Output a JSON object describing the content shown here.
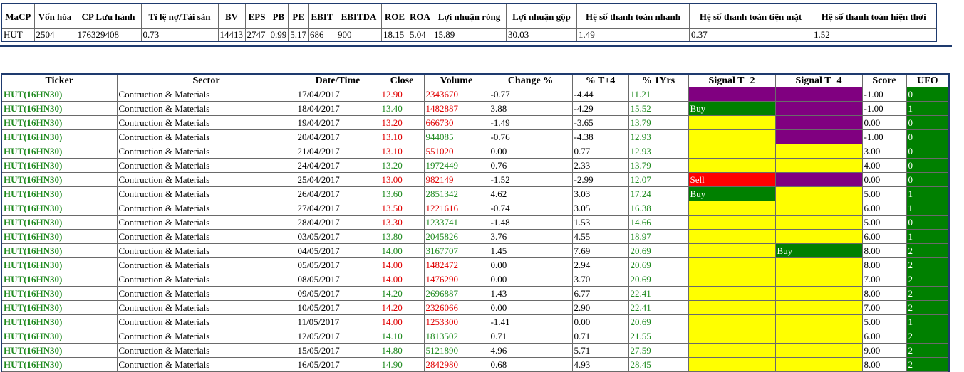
{
  "summary": {
    "headers": [
      "MaCP",
      "Vốn hóa",
      "CP Lưu hành",
      "Tỉ lệ nợ/Tài sản",
      "BV",
      "EPS",
      "PB",
      "PE",
      "EBIT",
      "EBITDA",
      "ROE",
      "ROA",
      "Lợi nhuận ròng",
      "Lợi nhuận gộp",
      "Hệ số thanh toán nhanh",
      "Hệ số thanh toán tiện mặt",
      "Hệ số thanh toán hiện thời"
    ],
    "values": [
      "HUT",
      "2504",
      "176329408",
      "0.73",
      "14413",
      "2747",
      "0.99",
      "5.17",
      "686",
      "900",
      "18.15",
      "5.04",
      "15.89",
      "30.03",
      "1.49",
      "0.37",
      "1.52"
    ]
  },
  "main": {
    "headers": [
      "Ticker",
      "Sector",
      "Date/Time",
      "Close",
      "Volume",
      "Change %",
      "% T+4",
      "% 1Yrs",
      "Signal T+2",
      "Signal T+4",
      "Score",
      "UFO"
    ],
    "rows": [
      {
        "ticker": "HUT(16HN30)",
        "sector": "Contruction & Materials",
        "date": "17/04/2017",
        "close": "12.90",
        "volume": "2343670",
        "change": "-0.77",
        "t4": "-4.44",
        "yr": "11.21",
        "sig2": "",
        "sig2c": "purple",
        "sig4": "",
        "sig4c": "purple",
        "score": "-1.00",
        "ufo": "0",
        "dir": "red"
      },
      {
        "ticker": "HUT(16HN30)",
        "sector": "Contruction & Materials",
        "date": "18/04/2017",
        "close": "13.40",
        "volume": "1482887",
        "change": "3.88",
        "t4": "-4.29",
        "yr": "15.52",
        "sig2": "Buy",
        "sig2c": "green",
        "sig4": "",
        "sig4c": "purple",
        "score": "-1.00",
        "ufo": "1",
        "dir": "green-red"
      },
      {
        "ticker": "HUT(16HN30)",
        "sector": "Contruction & Materials",
        "date": "19/04/2017",
        "close": "13.20",
        "volume": "666730",
        "change": "-1.49",
        "t4": "-3.65",
        "yr": "13.79",
        "sig2": "",
        "sig2c": "yellow",
        "sig4": "",
        "sig4c": "purple",
        "score": "0.00",
        "ufo": "0",
        "dir": "red"
      },
      {
        "ticker": "HUT(16HN30)",
        "sector": "Contruction & Materials",
        "date": "20/04/2017",
        "close": "13.10",
        "volume": "944085",
        "change": "-0.76",
        "t4": "-4.38",
        "yr": "12.93",
        "sig2": "",
        "sig2c": "yellow",
        "sig4": "",
        "sig4c": "purple",
        "score": "-1.00",
        "ufo": "0",
        "dir": "red-green"
      },
      {
        "ticker": "HUT(16HN30)",
        "sector": "Contruction & Materials",
        "date": "21/04/2017",
        "close": "13.10",
        "volume": "551020",
        "change": "0.00",
        "t4": "0.77",
        "yr": "12.93",
        "sig2": "",
        "sig2c": "yellow",
        "sig4": "",
        "sig4c": "yellow",
        "score": "3.00",
        "ufo": "0",
        "dir": "red"
      },
      {
        "ticker": "HUT(16HN30)",
        "sector": "Contruction & Materials",
        "date": "24/04/2017",
        "close": "13.20",
        "volume": "1972449",
        "change": "0.76",
        "t4": "2.33",
        "yr": "13.79",
        "sig2": "",
        "sig2c": "yellow",
        "sig4": "",
        "sig4c": "yellow",
        "score": "4.00",
        "ufo": "0",
        "dir": "green"
      },
      {
        "ticker": "HUT(16HN30)",
        "sector": "Contruction & Materials",
        "date": "25/04/2017",
        "close": "13.00",
        "volume": "982149",
        "change": "-1.52",
        "t4": "-2.99",
        "yr": "12.07",
        "sig2": "Sell",
        "sig2c": "red",
        "sig4": "",
        "sig4c": "purple",
        "score": "0.00",
        "ufo": "0",
        "dir": "red"
      },
      {
        "ticker": "HUT(16HN30)",
        "sector": "Contruction & Materials",
        "date": "26/04/2017",
        "close": "13.60",
        "volume": "2851342",
        "change": "4.62",
        "t4": "3.03",
        "yr": "17.24",
        "sig2": "Buy",
        "sig2c": "green",
        "sig4": "",
        "sig4c": "yellow",
        "score": "5.00",
        "ufo": "1",
        "dir": "green"
      },
      {
        "ticker": "HUT(16HN30)",
        "sector": "Contruction & Materials",
        "date": "27/04/2017",
        "close": "13.50",
        "volume": "1221616",
        "change": "-0.74",
        "t4": "3.05",
        "yr": "16.38",
        "sig2": "",
        "sig2c": "yellow",
        "sig4": "",
        "sig4c": "yellow",
        "score": "6.00",
        "ufo": "1",
        "dir": "red"
      },
      {
        "ticker": "HUT(16HN30)",
        "sector": "Contruction & Materials",
        "date": "28/04/2017",
        "close": "13.30",
        "volume": "1233741",
        "change": "-1.48",
        "t4": "1.53",
        "yr": "14.66",
        "sig2": "",
        "sig2c": "yellow",
        "sig4": "",
        "sig4c": "yellow",
        "score": "5.00",
        "ufo": "0",
        "dir": "red-green"
      },
      {
        "ticker": "HUT(16HN30)",
        "sector": "Contruction & Materials",
        "date": "03/05/2017",
        "close": "13.80",
        "volume": "2045826",
        "change": "3.76",
        "t4": "4.55",
        "yr": "18.97",
        "sig2": "",
        "sig2c": "yellow",
        "sig4": "",
        "sig4c": "yellow",
        "score": "6.00",
        "ufo": "1",
        "dir": "green"
      },
      {
        "ticker": "HUT(16HN30)",
        "sector": "Contruction & Materials",
        "date": "04/05/2017",
        "close": "14.00",
        "volume": "3167707",
        "change": "1.45",
        "t4": "7.69",
        "yr": "20.69",
        "sig2": "",
        "sig2c": "yellow",
        "sig4": "Buy",
        "sig4c": "green",
        "score": "8.00",
        "ufo": "2",
        "dir": "green"
      },
      {
        "ticker": "HUT(16HN30)",
        "sector": "Contruction & Materials",
        "date": "05/05/2017",
        "close": "14.00",
        "volume": "1482472",
        "change": "0.00",
        "t4": "2.94",
        "yr": "20.69",
        "sig2": "",
        "sig2c": "yellow",
        "sig4": "",
        "sig4c": "yellow",
        "score": "8.00",
        "ufo": "2",
        "dir": "red"
      },
      {
        "ticker": "HUT(16HN30)",
        "sector": "Contruction & Materials",
        "date": "08/05/2017",
        "close": "14.00",
        "volume": "1476290",
        "change": "0.00",
        "t4": "3.70",
        "yr": "20.69",
        "sig2": "",
        "sig2c": "yellow",
        "sig4": "",
        "sig4c": "yellow",
        "score": "7.00",
        "ufo": "2",
        "dir": "red"
      },
      {
        "ticker": "HUT(16HN30)",
        "sector": "Contruction & Materials",
        "date": "09/05/2017",
        "close": "14.20",
        "volume": "2696887",
        "change": "1.43",
        "t4": "6.77",
        "yr": "22.41",
        "sig2": "",
        "sig2c": "yellow",
        "sig4": "",
        "sig4c": "yellow",
        "score": "8.00",
        "ufo": "2",
        "dir": "green"
      },
      {
        "ticker": "HUT(16HN30)",
        "sector": "Contruction & Materials",
        "date": "10/05/2017",
        "close": "14.20",
        "volume": "2326066",
        "change": "0.00",
        "t4": "2.90",
        "yr": "22.41",
        "sig2": "",
        "sig2c": "yellow",
        "sig4": "",
        "sig4c": "yellow",
        "score": "7.00",
        "ufo": "2",
        "dir": "red"
      },
      {
        "ticker": "HUT(16HN30)",
        "sector": "Contruction & Materials",
        "date": "11/05/2017",
        "close": "14.00",
        "volume": "1253300",
        "change": "-1.41",
        "t4": "0.00",
        "yr": "20.69",
        "sig2": "",
        "sig2c": "yellow",
        "sig4": "",
        "sig4c": "yellow",
        "score": "5.00",
        "ufo": "1",
        "dir": "red"
      },
      {
        "ticker": "HUT(16HN30)",
        "sector": "Contruction & Materials",
        "date": "12/05/2017",
        "close": "14.10",
        "volume": "1813502",
        "change": "0.71",
        "t4": "0.71",
        "yr": "21.55",
        "sig2": "",
        "sig2c": "yellow",
        "sig4": "",
        "sig4c": "yellow",
        "score": "6.00",
        "ufo": "2",
        "dir": "green"
      },
      {
        "ticker": "HUT(16HN30)",
        "sector": "Contruction & Materials",
        "date": "15/05/2017",
        "close": "14.80",
        "volume": "5121890",
        "change": "4.96",
        "t4": "5.71",
        "yr": "27.59",
        "sig2": "",
        "sig2c": "yellow",
        "sig4": "",
        "sig4c": "yellow",
        "score": "9.00",
        "ufo": "2",
        "dir": "green"
      },
      {
        "ticker": "HUT(16HN30)",
        "sector": "Contruction & Materials",
        "date": "16/05/2017",
        "close": "14.90",
        "volume": "2842980",
        "change": "0.68",
        "t4": "4.93",
        "yr": "28.45",
        "sig2": "",
        "sig2c": "yellow",
        "sig4": "",
        "sig4c": "yellow",
        "score": "8.00",
        "ufo": "2",
        "dir": "green-red"
      }
    ]
  },
  "colors": {
    "border": "#1e3a6e",
    "gain": "#1f8a1f",
    "loss": "#e00000",
    "signal_neutral": "#ffff00",
    "signal_hold": "#800080",
    "signal_buy": "#008000",
    "signal_sell": "#ff0000"
  }
}
